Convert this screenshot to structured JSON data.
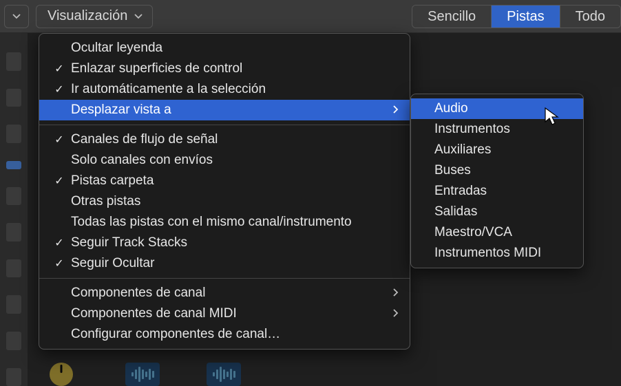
{
  "toolbar": {
    "menu_label": "Visualización",
    "view_modes": {
      "simple": "Sencillo",
      "tracks": "Pistas",
      "all": "Todo"
    }
  },
  "menu": {
    "group1": [
      {
        "checked": false,
        "label": "Ocultar leyenda"
      },
      {
        "checked": true,
        "label": "Enlazar superficies de control"
      },
      {
        "checked": true,
        "label": "Ir automáticamente a la selección"
      },
      {
        "checked": false,
        "label": "Desplazar vista a",
        "submenu": true,
        "highlight": true
      }
    ],
    "group2": [
      {
        "checked": true,
        "label": "Canales de flujo de señal"
      },
      {
        "checked": false,
        "label": "Solo canales con envíos"
      },
      {
        "checked": true,
        "label": "Pistas carpeta"
      },
      {
        "checked": false,
        "label": "Otras pistas"
      },
      {
        "checked": false,
        "label": "Todas las pistas con el mismo canal/instrumento"
      },
      {
        "checked": true,
        "label": "Seguir Track Stacks"
      },
      {
        "checked": true,
        "label": "Seguir Ocultar"
      }
    ],
    "group3": [
      {
        "label": "Componentes de canal",
        "submenu": true
      },
      {
        "label": "Componentes de canal MIDI",
        "submenu": true
      },
      {
        "label": "Configurar componentes de canal…"
      }
    ]
  },
  "submenu": {
    "items": [
      {
        "label": "Audio",
        "highlight": true
      },
      {
        "label": "Instrumentos"
      },
      {
        "label": "Auxiliares"
      },
      {
        "label": "Buses"
      },
      {
        "label": "Entradas"
      },
      {
        "label": "Salidas"
      },
      {
        "label": "Maestro/VCA"
      },
      {
        "label": "Instrumentos MIDI"
      }
    ]
  }
}
